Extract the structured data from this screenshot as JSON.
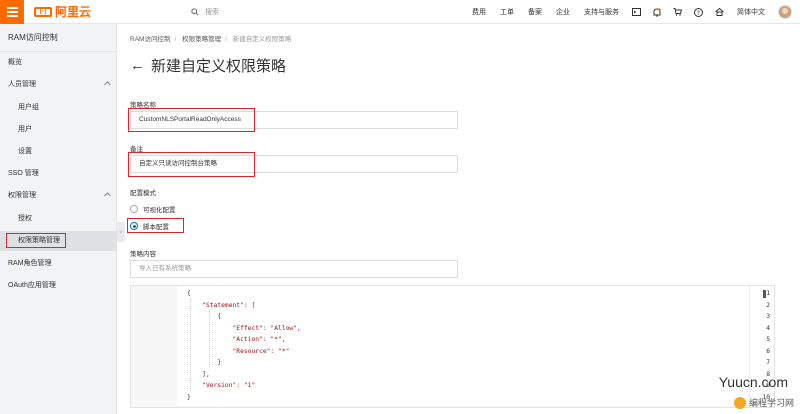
{
  "topbar": {
    "logo_mark": "(-)",
    "logo_text": "阿里云",
    "search_placeholder": "搜索",
    "links": [
      "费用",
      "工单",
      "备案",
      "企业",
      "支持与服务"
    ],
    "lang": "简体中文"
  },
  "sidebar": {
    "title": "RAM访问控制",
    "items": [
      {
        "label": "概览"
      },
      {
        "label": "人员管理"
      },
      {
        "label": "用户组"
      },
      {
        "label": "用户"
      },
      {
        "label": "设置"
      },
      {
        "label": "SSO 管理"
      },
      {
        "label": "权限管理"
      },
      {
        "label": "授权"
      },
      {
        "label": "权限策略管理"
      },
      {
        "label": "RAM角色管理"
      },
      {
        "label": "OAuth应用管理"
      }
    ]
  },
  "breadcrumb": [
    "RAM访问控制",
    "权限策略管理",
    "新建自定义权限策略"
  ],
  "page": {
    "title": "新建自定义权限策略"
  },
  "form": {
    "name_label": "策略名称",
    "name_value": "CustomNLSPortalReadOnlyAccess",
    "note_label": "备注",
    "note_value": "自定义只读访问控制台策略",
    "mode_label": "配置模式",
    "mode_options": [
      "可视化配置",
      "脚本配置"
    ],
    "mode_selected": "脚本配置",
    "content_label": "策略内容",
    "import_placeholder": "导入已有系统策略"
  },
  "editor": {
    "line_numbers": [
      "1",
      "2",
      "3",
      "4",
      "5",
      "6",
      "7",
      "8",
      "9",
      "10"
    ],
    "lines": [
      "{",
      "    \"Statement\": [",
      "        {",
      "            \"Effect\": \"Allow\",",
      "            \"Action\": \"*\",",
      "            \"Resource\": \"*\"",
      "        }",
      "    ],",
      "    \"Version\": \"1\"",
      "}"
    ]
  },
  "watermark": {
    "site": "Yuucn.com",
    "brand": "编程学习网"
  },
  "colors": {
    "brand_orange": "#ff6a00",
    "highlight_red": "#d9262c",
    "radio_blue": "#0070cc"
  }
}
